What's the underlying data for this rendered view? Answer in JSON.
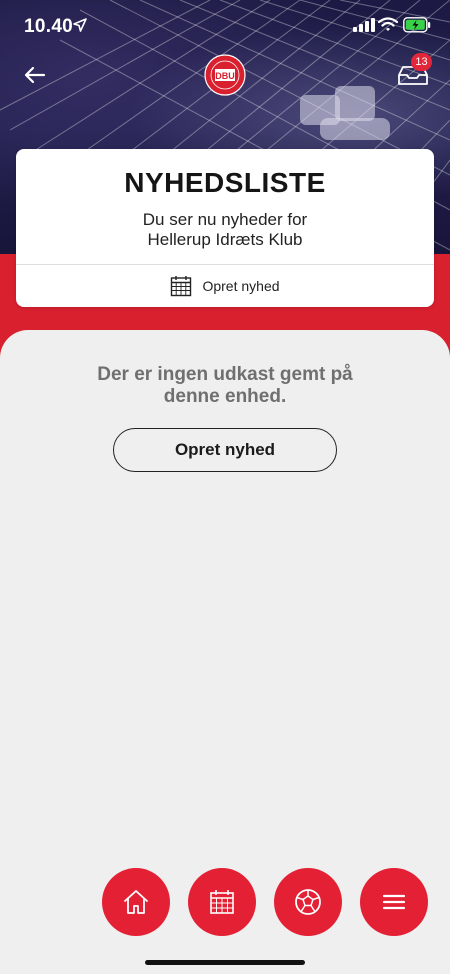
{
  "status_bar": {
    "time": "10.40"
  },
  "header": {
    "logo_text": "DBU",
    "inbox_badge_count": "13"
  },
  "card": {
    "title": "NYHEDSLISTE",
    "subtitle_line1": "Du ser nu nyheder for",
    "subtitle_line2": "Hellerup Idræts Klub",
    "action_label": "Opret nyhed",
    "action_icon": "calendar-icon"
  },
  "main": {
    "empty_message_line1": "Der er ingen udkast gemt på",
    "empty_message_line2": "denne enhed.",
    "create_button_label": "Opret nyhed"
  },
  "bottom_nav": {
    "items": [
      {
        "icon": "home-icon"
      },
      {
        "icon": "calendar-icon"
      },
      {
        "icon": "football-icon"
      },
      {
        "icon": "menu-icon"
      }
    ]
  },
  "colors": {
    "brand_red": "#e42034",
    "band_red": "#d8202f",
    "hero_dark": "#1c1a44",
    "background": "#f0eff0",
    "text_gray": "#6f6f6f"
  }
}
